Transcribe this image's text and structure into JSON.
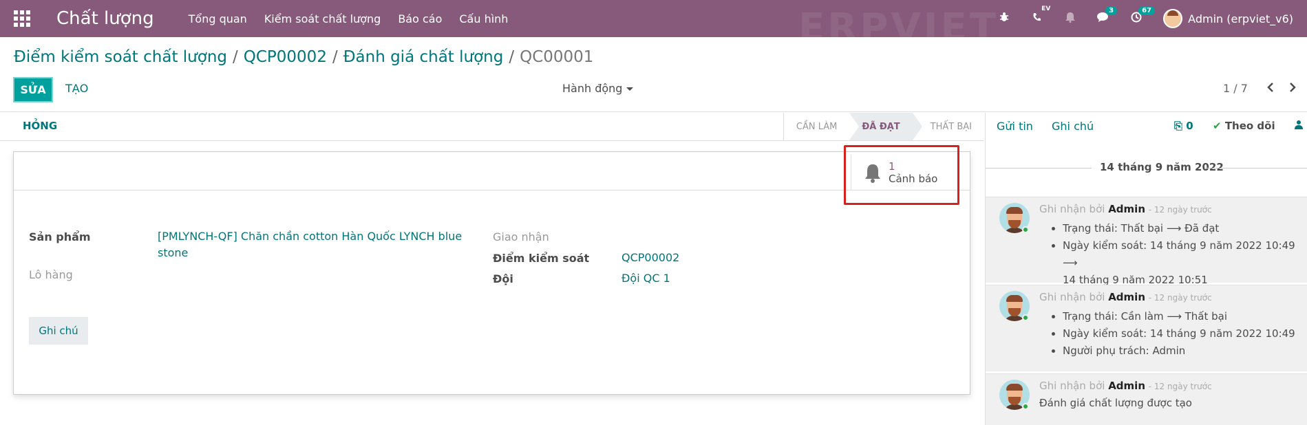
{
  "navbar": {
    "brand": "Chất lượng",
    "menu": [
      "Tổng quan",
      "Kiểm soát chất lượng",
      "Báo cáo",
      "Cấu hình"
    ],
    "icons": [
      "bug-icon",
      "phone-icon",
      "bell-icon",
      "chat-icon",
      "clock-icon"
    ],
    "phone_badge": "EV",
    "chat_badge": "3",
    "activity_badge": "67",
    "user": "Admin (erpviet_v6)",
    "watermark": "ERPVIET",
    "color": "#875a7b"
  },
  "breadcrumb": {
    "items": [
      "Điểm kiểm soát chất lượng",
      "QCP00002",
      "Đánh giá chất lượng"
    ],
    "current": "QC00001",
    "separator": "/"
  },
  "controls": {
    "edit": "SỬA",
    "create": "TẠO",
    "actions": "Hành động",
    "pager": "1 / 7",
    "prev": "‹",
    "next": "›",
    "accent": "#00a09d"
  },
  "statusbar": {
    "fail_button": "HỎNG",
    "stages": [
      "CẦN LÀM",
      "ĐÃ ĐẠT",
      "THẤT BẠI"
    ],
    "current_stage": "ĐÃ ĐẠT"
  },
  "alert": {
    "count": "1",
    "label": "Cảnh báo"
  },
  "form": {
    "product_label": "Sản phẩm",
    "product_value_line1": "[PMLYNCH-QF] Chăn chần cotton Hàn Quốc LYNCH blue",
    "product_value_line2": "stone",
    "lot_label": "Lô hàng",
    "picking_label": "Giao nhận",
    "point_label": "Điểm kiểm soát",
    "point_value": "QCP00002",
    "team_label": "Đội",
    "team_value": "Đội QC 1",
    "note_tab": "Ghi chú"
  },
  "chatter": {
    "send_message": "Gửi tin",
    "log_note": "Ghi chú",
    "attachments": "0",
    "follow": "Theo dõi",
    "date": "14 tháng 9 năm 2022",
    "messages": [
      {
        "prefix": "Ghi nhận bởi",
        "author": "Admin",
        "time": "- 12 ngày trước",
        "lines": [
          "Trạng thái: Thất bại ⟶ Đã đạt",
          "Ngày kiểm soát: 14 tháng 9 năm 2022 10:49 ⟶",
          "14 tháng 9 năm 2022 10:51"
        ]
      },
      {
        "prefix": "Ghi nhận bởi",
        "author": "Admin",
        "time": "- 12 ngày trước",
        "lines": [
          "Trạng thái: Cần làm ⟶ Thất bại",
          "Ngày kiểm soát: 14 tháng 9 năm 2022 10:49",
          "Người phụ trách: Admin"
        ]
      },
      {
        "prefix": "Ghi nhận bởi",
        "author": "Admin",
        "time": "- 12 ngày trước",
        "text": "Đánh giá chất lượng được tạo"
      }
    ]
  }
}
